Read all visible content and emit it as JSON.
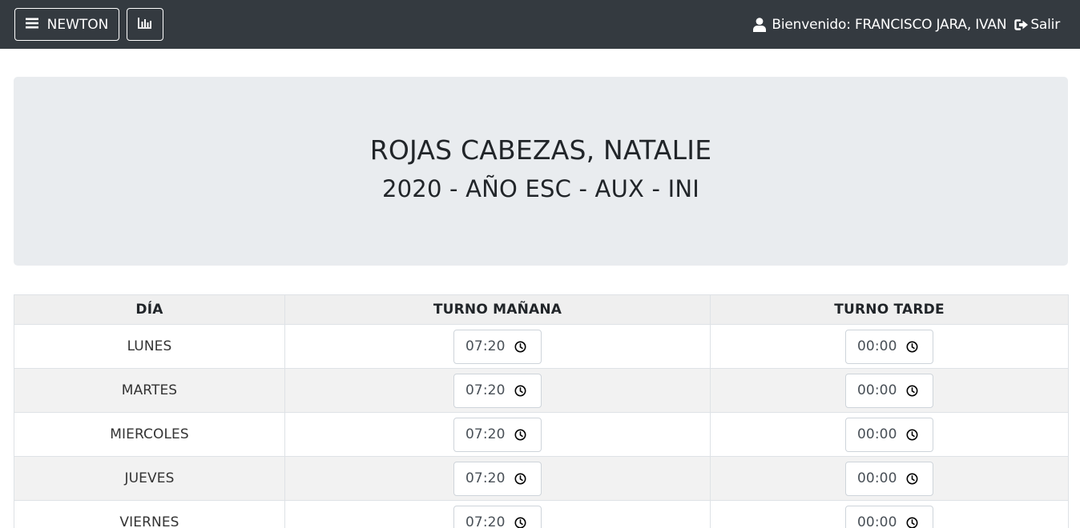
{
  "navbar": {
    "menu_label": "NEWTON",
    "menu_icon": "hamburger-icon",
    "stats_icon": "bar-chart-icon",
    "welcome_text": "Bienvenido: FRANCISCO JARA, IVAN",
    "logout_label": "Salir"
  },
  "header": {
    "name": "ROJAS CABEZAS, NATALIE",
    "subtitle": "2020 - AÑO ESC - AUX - INI"
  },
  "schedule": {
    "columns": [
      "DÍA",
      "TURNO MAÑANA",
      "TURNO TARDE"
    ],
    "rows": [
      {
        "day": "LUNES",
        "morning": "07:20",
        "afternoon": "00:00"
      },
      {
        "day": "MARTES",
        "morning": "07:20",
        "afternoon": "00:00"
      },
      {
        "day": "MIERCOLES",
        "morning": "07:20",
        "afternoon": "00:00"
      },
      {
        "day": "JUEVES",
        "morning": "07:20",
        "afternoon": "00:00"
      },
      {
        "day": "VIERNES",
        "morning": "07:20",
        "afternoon": "00:00"
      }
    ]
  },
  "colors": {
    "navbar": "#343a40",
    "jumbotron": "#e9ecef",
    "table_header": "#efefef",
    "row_striped": "#f2f2f2"
  }
}
